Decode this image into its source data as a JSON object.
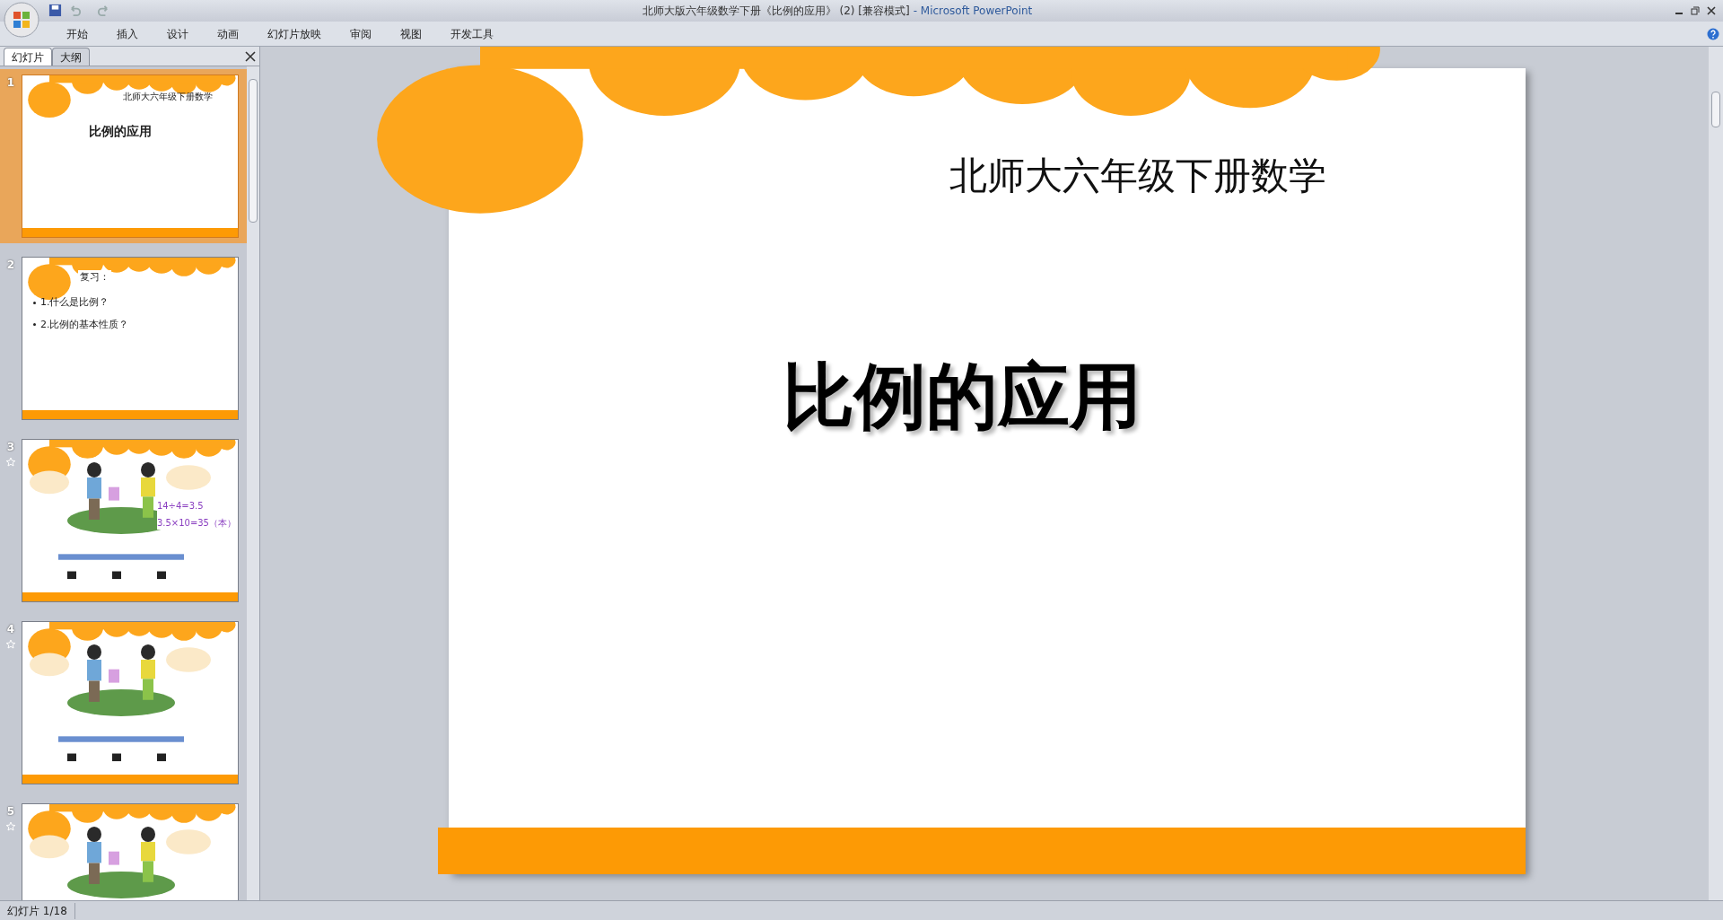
{
  "window": {
    "title": "北师大版六年级数学下册《比例的应用》 (2) [兼容模式]",
    "app_name": "- Microsoft PowerPoint"
  },
  "ribbon_tabs": [
    "开始",
    "插入",
    "设计",
    "动画",
    "幻灯片放映",
    "审阅",
    "视图",
    "开发工具"
  ],
  "panel_tabs": [
    {
      "label": "幻灯片",
      "selected": true
    },
    {
      "label": "大纲",
      "selected": false
    }
  ],
  "thumbnails": [
    {
      "number": "1",
      "selected": true,
      "animated": false,
      "kind": "title",
      "subtitle": "北师大六年级下册数学",
      "title": "比例的应用"
    },
    {
      "number": "2",
      "selected": false,
      "animated": false,
      "kind": "bullets",
      "title": "复习：",
      "bullets": [
        "1.什么是比例？",
        "2.比例的基本性质？"
      ]
    },
    {
      "number": "3",
      "selected": false,
      "animated": true,
      "kind": "picture",
      "equations": [
        "14÷4=3.5",
        "3.5×10=35（本）"
      ]
    },
    {
      "number": "4",
      "selected": false,
      "animated": true,
      "kind": "picture"
    },
    {
      "number": "5",
      "selected": false,
      "animated": true,
      "kind": "picture"
    }
  ],
  "slide": {
    "subtitle": "北师大六年级下册数学",
    "title": "比例的应用"
  },
  "status_bar": {
    "slide_indicator": "幻灯片 1/18"
  }
}
